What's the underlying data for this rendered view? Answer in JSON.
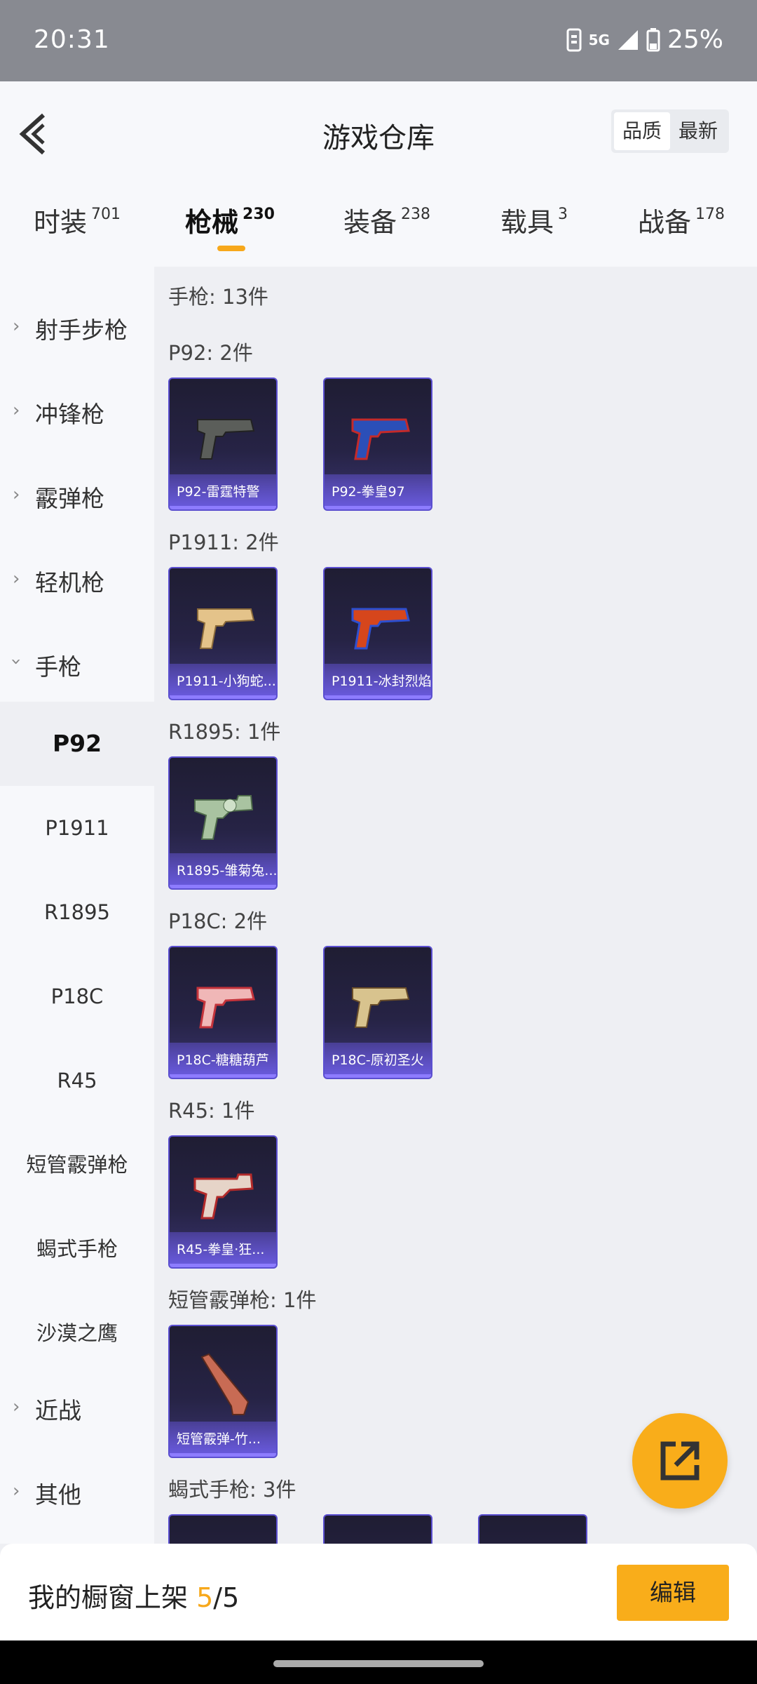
{
  "status_bar": {
    "time": "20:31",
    "network": "5G",
    "battery": "25%"
  },
  "header": {
    "title": "游戏仓库",
    "sort_options": [
      {
        "label": "品质",
        "selected": true
      },
      {
        "label": "最新",
        "selected": false
      }
    ]
  },
  "tabs": [
    {
      "label": "时装",
      "count": "701",
      "active": false
    },
    {
      "label": "枪械",
      "count": "230",
      "active": true
    },
    {
      "label": "装备",
      "count": "238",
      "active": false
    },
    {
      "label": "载具",
      "count": "3",
      "active": false
    },
    {
      "label": "战备",
      "count": "178",
      "active": false
    }
  ],
  "sidebar": {
    "categories": [
      {
        "label": "射手步枪",
        "expanded": false
      },
      {
        "label": "冲锋枪",
        "expanded": false
      },
      {
        "label": "霰弹枪",
        "expanded": false
      },
      {
        "label": "轻机枪",
        "expanded": false
      },
      {
        "label": "手枪",
        "expanded": true
      },
      {
        "label": "近战",
        "expanded": false
      },
      {
        "label": "其他",
        "expanded": false
      }
    ],
    "subitems": [
      {
        "label": "P92",
        "selected": true
      },
      {
        "label": "P1911",
        "selected": false
      },
      {
        "label": "R1895",
        "selected": false
      },
      {
        "label": "P18C",
        "selected": false
      },
      {
        "label": "R45",
        "selected": false
      },
      {
        "label": "短管霰弹枪",
        "selected": false
      },
      {
        "label": "蝎式手枪",
        "selected": false
      },
      {
        "label": "沙漠之鹰",
        "selected": false
      }
    ]
  },
  "content": {
    "summary": "手枪: 13件",
    "groups": [
      {
        "title": "P92: 2件",
        "items": [
          "P92-雷霆特警",
          "P92-拳皇97"
        ]
      },
      {
        "title": "P1911: 2件",
        "items": [
          "P1911-小狗蛇...",
          "P1911-冰封烈焰"
        ]
      },
      {
        "title": "R1895: 1件",
        "items": [
          "R1895-雏菊兔..."
        ]
      },
      {
        "title": "P18C: 2件",
        "items": [
          "P18C-糖糖葫芦",
          "P18C-原初圣火"
        ]
      },
      {
        "title": "R45: 1件",
        "items": [
          "R45-拳皇·狂..."
        ]
      },
      {
        "title": "短管霰弹枪: 1件",
        "items": [
          "短管霰弹-竹..."
        ]
      },
      {
        "title": "蝎式手枪: 3件",
        "items": [
          "",
          "",
          ""
        ]
      }
    ]
  },
  "footer": {
    "label": "我的橱窗上架",
    "current": "5",
    "total": "/5",
    "edit_label": "编辑"
  },
  "colors": {
    "accent": "#f9ad1a",
    "card_border": "#5b4fd0"
  },
  "icons": {
    "back": "chevron-left-icon",
    "fab": "share-external-icon"
  }
}
